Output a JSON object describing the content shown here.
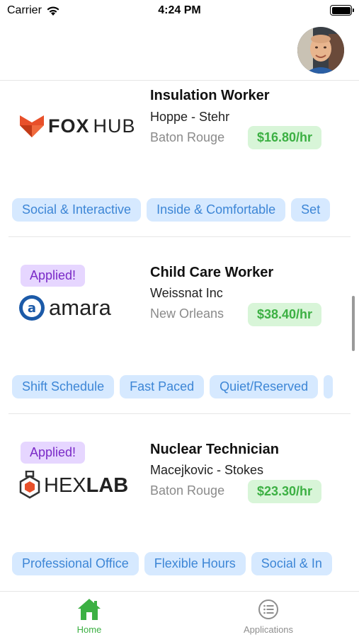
{
  "status_bar": {
    "carrier": "Carrier",
    "time": "4:24 PM"
  },
  "colors": {
    "accent_green": "#3cb043",
    "tag_blue": "#3d86d6",
    "applied_purple": "#7a2ac7"
  },
  "jobs": [
    {
      "title": "Insulation Worker",
      "company": "Hoppe - Stehr",
      "city": "Baton Rouge",
      "rate": "$16.80/hr",
      "applied": false,
      "logo": {
        "name": "fox-hub-logo",
        "text_a": "FOX",
        "text_b": "HUB"
      },
      "tags": [
        "Social & Interactive",
        "Inside & Comfortable",
        "Set"
      ]
    },
    {
      "title": "Child Care Worker",
      "company": "Weissnat Inc",
      "city": "New Orleans",
      "rate": "$38.40/hr",
      "applied": true,
      "applied_label": "Applied!",
      "logo": {
        "name": "amara-logo",
        "text_a": "amara"
      },
      "tags": [
        "Shift Schedule",
        "Fast Paced",
        "Quiet/Reserved",
        ""
      ]
    },
    {
      "title": "Nuclear Technician",
      "company": "Macejkovic - Stokes",
      "city": "Baton Rouge",
      "rate": "$23.30/hr",
      "applied": true,
      "applied_label": "Applied!",
      "logo": {
        "name": "hexlab-logo",
        "text_a": "HEX",
        "text_b": "LAB"
      },
      "tags": [
        "Professional Office",
        "Flexible Hours",
        "Social & In"
      ]
    }
  ],
  "tabbar": {
    "tabs": [
      {
        "label": "Home",
        "icon": "home-icon",
        "active": true
      },
      {
        "label": "Applications",
        "icon": "list-icon",
        "active": false
      }
    ]
  }
}
